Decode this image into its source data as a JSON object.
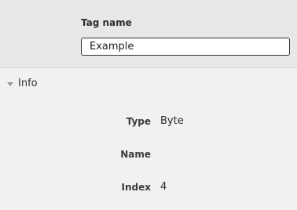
{
  "tag": {
    "label": "Tag name",
    "value": "Example"
  },
  "section": {
    "title": "Info",
    "expanded": true
  },
  "properties": [
    {
      "label": "Type",
      "value": "Byte"
    },
    {
      "label": "Name",
      "value": ""
    },
    {
      "label": "Index",
      "value": "4"
    }
  ],
  "colors": {
    "header_bg": "#e6e8ea",
    "panel_bg": "#f1f1f1",
    "input_border": "#333333"
  }
}
